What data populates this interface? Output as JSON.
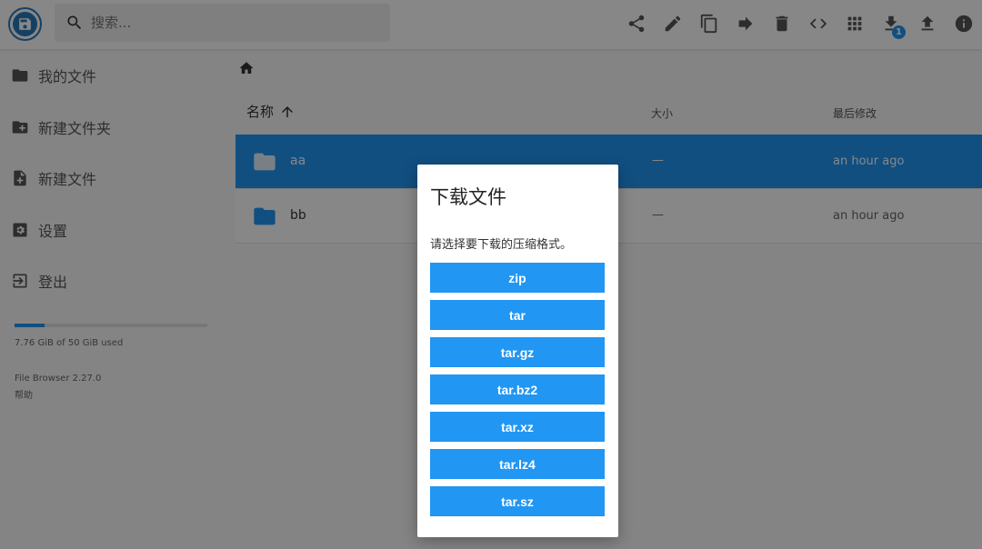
{
  "header": {
    "search_placeholder": "搜索...",
    "download_badge": "1",
    "toolbar_icons": [
      "share-icon",
      "edit-icon",
      "copy-icon",
      "move-icon",
      "delete-icon",
      "code-icon",
      "grid-view-icon",
      "download-icon",
      "upload-icon",
      "info-icon"
    ]
  },
  "sidebar": {
    "items": [
      {
        "label": "我的文件",
        "icon": "folder-icon"
      },
      {
        "label": "新建文件夹",
        "icon": "folder-plus-icon"
      },
      {
        "label": "新建文件",
        "icon": "file-plus-icon"
      },
      {
        "label": "设置",
        "icon": "settings-icon"
      },
      {
        "label": "登出",
        "icon": "logout-icon"
      }
    ],
    "usage_fraction": 0.155,
    "usage_text": "7.76 GiB of 50 GiB used",
    "version": "File Browser 2.27.0",
    "help": "帮助"
  },
  "list": {
    "headers": {
      "name": "名称",
      "size": "大小",
      "modified": "最后修改"
    },
    "rows": [
      {
        "name": "aa",
        "size": "—",
        "modified": "an hour ago",
        "selected": true
      },
      {
        "name": "bb",
        "size": "—",
        "modified": "an hour ago",
        "selected": false
      }
    ]
  },
  "dialog": {
    "title": "下载文件",
    "message": "请选择要下载的压缩格式。",
    "formats": [
      "zip",
      "tar",
      "tar.gz",
      "tar.bz2",
      "tar.xz",
      "tar.lz4",
      "tar.sz"
    ]
  },
  "colors": {
    "accent": "#2196f3",
    "logo": "#2979b9"
  }
}
